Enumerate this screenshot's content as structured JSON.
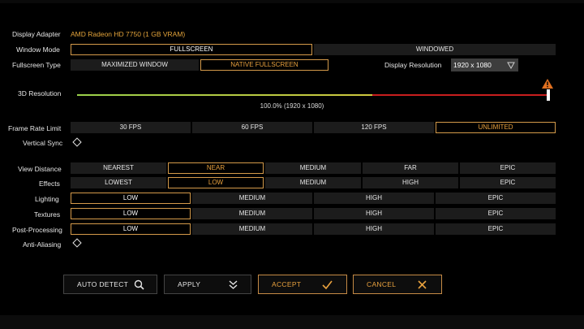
{
  "labels": {
    "display_adapter": "Display Adapter",
    "window_mode": "Window Mode",
    "fullscreen_type": "Fullscreen Type",
    "display_resolution": "Display Resolution",
    "resolution_3d": "3D Resolution",
    "frame_rate_limit": "Frame Rate Limit",
    "vertical_sync": "Vertical Sync",
    "view_distance": "View Distance",
    "effects": "Effects",
    "lighting": "Lighting",
    "textures": "Textures",
    "post_processing": "Post-Processing",
    "anti_aliasing": "Anti-Aliasing"
  },
  "display_adapter_value": "AMD Radeon HD 7750 (1 GB VRAM)",
  "window_mode": {
    "fullscreen": "FULLSCREEN",
    "windowed": "WINDOWED"
  },
  "fullscreen_type": {
    "maximized": "MAXIMIZED WINDOW",
    "native": "NATIVE FULLSCREEN"
  },
  "display_resolution_value": "1920 x 1080",
  "resolution_3d": {
    "readout": "100.0%  (1920 x 1080)",
    "level": 1.0
  },
  "frame_rate": {
    "fps30": "30 FPS",
    "fps60": "60 FPS",
    "fps120": "120 FPS",
    "unlimited": "UNLIMITED"
  },
  "view_distance": {
    "nearest": "NEAREST",
    "near": "NEAR",
    "medium": "MEDIUM",
    "far": "FAR",
    "epic": "EPIC"
  },
  "effects": {
    "lowest": "LOWEST",
    "low": "LOW",
    "medium": "MEDIUM",
    "high": "HIGH",
    "epic": "EPIC"
  },
  "lighting": {
    "low": "LOW",
    "medium": "MEDIUM",
    "high": "HIGH",
    "epic": "EPIC"
  },
  "textures": {
    "low": "LOW",
    "medium": "MEDIUM",
    "high": "HIGH",
    "epic": "EPIC"
  },
  "post_processing": {
    "low": "LOW",
    "medium": "MEDIUM",
    "high": "HIGH",
    "epic": "EPIC"
  },
  "buttons": {
    "auto_detect": "AUTO DETECT",
    "apply": "APPLY",
    "accept": "ACCEPT",
    "cancel": "CANCEL"
  },
  "icons": {
    "auto_detect": "search-icon",
    "apply": "double-chevron-down-icon",
    "accept": "checkmark-icon",
    "cancel": "close-icon",
    "warning": "warning-icon",
    "dropdown": "triangle-down-icon"
  },
  "colors": {
    "accent": "#e8a13e",
    "selected_border": "#d49a4a",
    "slider_green": "#9ad04a",
    "slider_yellow": "#d8c43a",
    "slider_red": "#c81e1e",
    "warning": "#e07020"
  }
}
